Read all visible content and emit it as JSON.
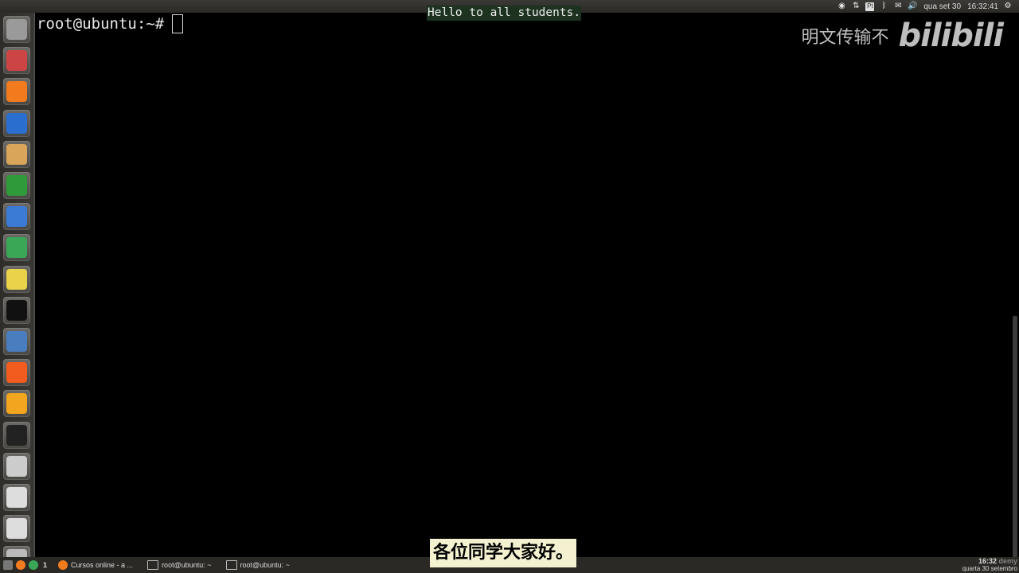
{
  "window": {
    "prompt": "root@ubuntu:~#"
  },
  "notice": "Hello to all students.",
  "watermark": {
    "text": "明文传输不",
    "logo": "bilibili"
  },
  "subtitle": "各位同学大家好。",
  "top_panel": {
    "date": "qua set 30",
    "time": "16:32:41",
    "icons": [
      "obs-icon",
      "network-icon",
      "keyboard-layout-icon",
      "bluetooth-icon",
      "mail-icon",
      "volume-icon",
      "gear-icon"
    ],
    "keyboard": "Pt"
  },
  "launcher": {
    "items": [
      {
        "name": "dash-icon",
        "color": "#9a9a9a"
      },
      {
        "name": "files-icon",
        "color": "#c44"
      },
      {
        "name": "firefox-icon",
        "color": "#f27b1e"
      },
      {
        "name": "writer-icon",
        "color": "#2a6fd0"
      },
      {
        "name": "text-editor-icon",
        "color": "#d9a55b"
      },
      {
        "name": "calc-icon",
        "color": "#2f9a3a"
      },
      {
        "name": "thunderbird-icon",
        "color": "#3b7bd6"
      },
      {
        "name": "chrome-icon",
        "color": "#3aa757"
      },
      {
        "name": "rhythmbox-icon",
        "color": "#e8d34a"
      },
      {
        "name": "terminal-icon",
        "color": "#111"
      },
      {
        "name": "virtualbox-icon",
        "color": "#4a7dbf"
      },
      {
        "name": "firefox-alt-icon",
        "color": "#f25c1e"
      },
      {
        "name": "sublime-icon",
        "color": "#f2a51e"
      },
      {
        "name": "obs-launcher-icon",
        "color": "#222"
      },
      {
        "name": "drive-icon",
        "color": "#ccc"
      },
      {
        "name": "usb-drive-icon",
        "color": "#ddd"
      },
      {
        "name": "usb-drive-2-icon",
        "color": "#ddd"
      },
      {
        "name": "trash-icon",
        "color": "#bbb"
      }
    ]
  },
  "taskbar": {
    "workspace": "1",
    "tasks": [
      "Cursos online - a ...",
      "root@ubuntu: ~",
      "root@ubuntu: ~"
    ],
    "clock_time": "16:32",
    "clock_date": "quarta 30 setembro",
    "brand": "demy"
  }
}
